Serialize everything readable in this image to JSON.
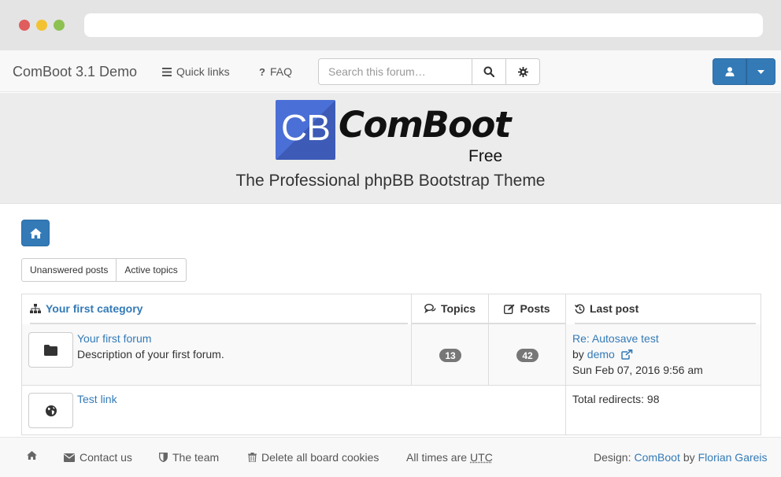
{
  "navbar": {
    "brand": "ComBoot 3.1 Demo",
    "quick_links": "Quick links",
    "faq": "FAQ",
    "search_placeholder": "Search this forum…"
  },
  "banner": {
    "logo_box_text": "CB",
    "logo_name": "ComBoot",
    "logo_free": "Free",
    "tagline": "The Professional phpBB Bootstrap Theme"
  },
  "quick_buttons": {
    "unanswered": "Unanswered posts",
    "active": "Active topics"
  },
  "forum_table": {
    "category": "Your first category",
    "col_topics": "Topics",
    "col_posts": "Posts",
    "col_last_post": "Last post",
    "forum": {
      "title": "Your first forum",
      "description": "Description of your first forum.",
      "topics": "13",
      "posts": "42",
      "last_post_title": "Re: Autosave test",
      "by": "by",
      "author": "demo",
      "date": "Sun Feb 07, 2016 9:56 am"
    },
    "link_forum": {
      "title": "Test link",
      "redirects": "Total redirects: 98"
    }
  },
  "footer": {
    "contact": "Contact us",
    "team": "The team",
    "delete_cookies": "Delete all board cookies",
    "times_prefix": "All times are",
    "timezone": "UTC",
    "design_prefix": "Design:",
    "design_theme": "ComBoot",
    "design_by": "by",
    "design_author": "Florian Gareis"
  },
  "colors": {
    "primary": "#337ab7",
    "badge": "#777777",
    "logo_blue": "#4a6fd6"
  }
}
